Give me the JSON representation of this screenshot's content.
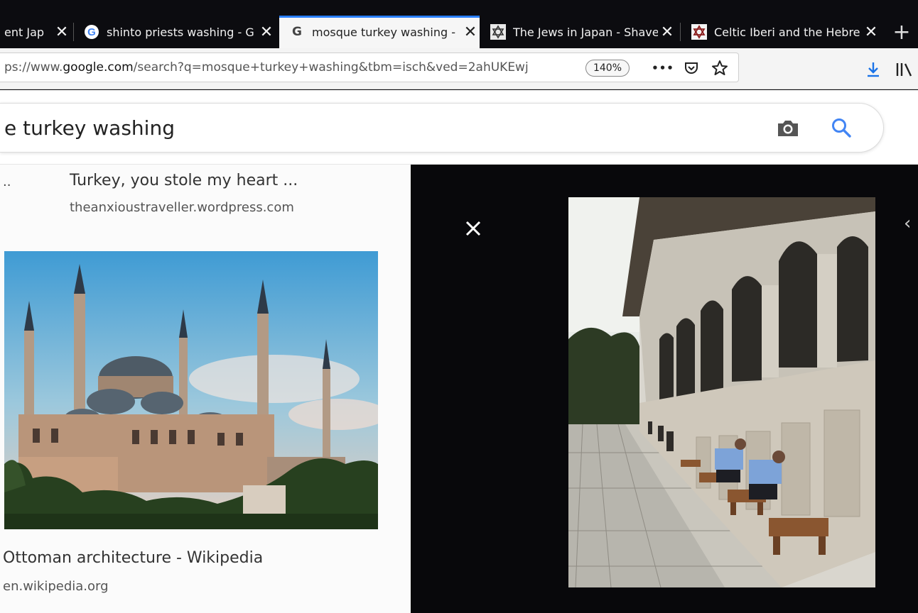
{
  "tabs": [
    {
      "title": "ent Jap",
      "favicon": "",
      "active": false
    },
    {
      "title": "shinto priests washing - G",
      "favicon": "google-icon",
      "active": false
    },
    {
      "title": "mosque turkey washing -",
      "favicon": "google-icon",
      "active": true
    },
    {
      "title": "The Jews in Japan - Shave",
      "favicon": "star-of-david-icon",
      "active": false
    },
    {
      "title": "Celtic Iberi and the Hebre",
      "favicon": "star-of-david-icon",
      "active": false
    }
  ],
  "new_tab_label": "+",
  "close_glyph": "✕",
  "address": {
    "prefix": "ps://www.",
    "host": "google.com",
    "path": "/search?q=mosque+turkey+washing&tbm=isch&ved=2ahUKEwj",
    "zoom": "140%"
  },
  "toolbar": {
    "more_glyph": "•••",
    "pocket_icon": "pocket-icon",
    "bookmark_icon": "star-icon",
    "download_icon": "download-arrow-icon",
    "library_icon": "library-icon"
  },
  "search": {
    "query": "e turkey washing",
    "camera_icon": "camera-icon",
    "search_icon": "magnifier-icon"
  },
  "results": [
    {
      "title": "Turkey, you stole my heart ...",
      "site": "theanxioustraveller.wordpress.com",
      "prefix": ".."
    },
    {
      "title": "Ottoman architecture - Wikipedia",
      "site": "en.wikipedia.org"
    }
  ],
  "preview": {
    "close_icon": "close-icon",
    "prev_glyph": "‹"
  },
  "colors": {
    "tab_bg": "#0c0c10",
    "active_tab": "#f6f6f6",
    "accent": "#2a7fff",
    "preview_bg": "#08080b",
    "google_blue": "#4285f4",
    "download_blue": "#1a73e8"
  }
}
